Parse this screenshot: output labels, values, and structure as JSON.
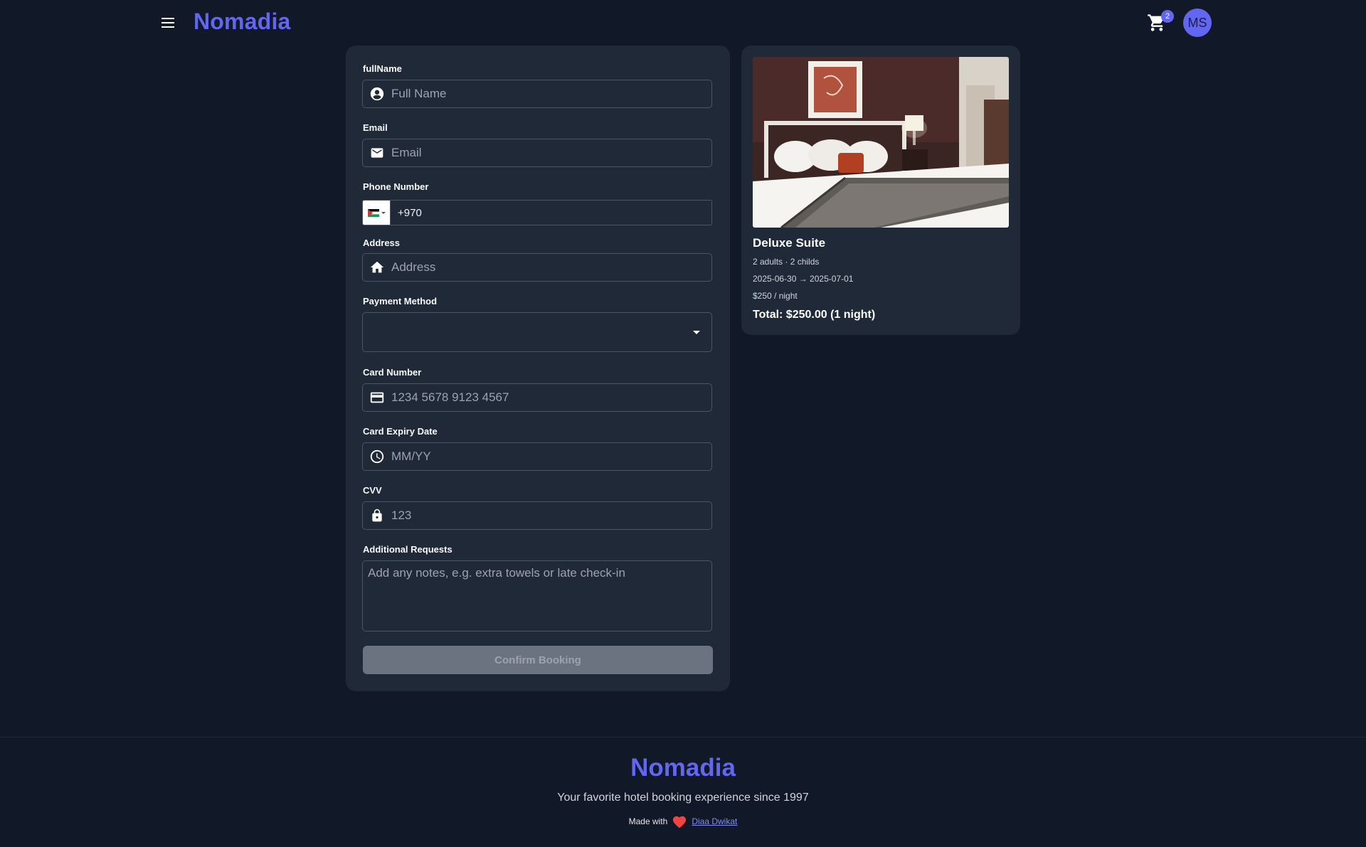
{
  "header": {
    "brand": "Nomadia",
    "cart_count": "2",
    "avatar_initials": "MS",
    "accent_color": "#6366f1"
  },
  "form": {
    "full_name": {
      "label": "fullName",
      "placeholder": "Full Name",
      "icon": "account-circle-icon"
    },
    "email": {
      "label": "Email",
      "placeholder": "Email",
      "icon": "mail-icon"
    },
    "phone": {
      "label": "Phone Number",
      "value": "+970",
      "flag": "palestine-flag-icon"
    },
    "address": {
      "label": "Address",
      "placeholder": "Address",
      "icon": "home-icon"
    },
    "payment_method": {
      "label": "Payment Method",
      "value": ""
    },
    "card_number": {
      "label": "Card Number",
      "placeholder": "1234 5678 9123 4567",
      "icon": "credit-card-icon"
    },
    "card_expiry": {
      "label": "Card Expiry Date",
      "placeholder": "MM/YY",
      "icon": "clock-icon"
    },
    "cvv": {
      "label": "CVV",
      "placeholder": "123",
      "icon": "lock-icon"
    },
    "requests": {
      "label": "Additional Requests",
      "placeholder": "Add any notes, e.g. extra towels or late check-in"
    },
    "confirm_label": "Confirm Booking"
  },
  "summary": {
    "room_name": "Deluxe Suite",
    "guests": "2 adults · 2 childs",
    "dates": "2025-06-30 → 2025-07-01",
    "price": "$250 / night",
    "total": "Total: $250.00 (1 night)"
  },
  "footer": {
    "brand": "Nomadia",
    "tagline": "Your favorite hotel booking experience since 1997",
    "made_with": "Made with",
    "author": "Diaa Dwikat"
  }
}
